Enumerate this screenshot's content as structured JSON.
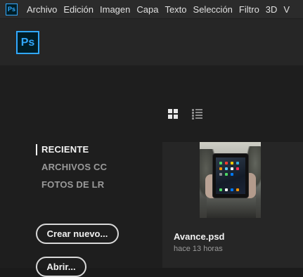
{
  "menubar": {
    "app_icon": "Ps",
    "items": [
      "Archivo",
      "Edición",
      "Imagen",
      "Capa",
      "Texto",
      "Selección",
      "Filtro",
      "3D",
      "V"
    ]
  },
  "header": {
    "logo": "Ps"
  },
  "view_toggle": {
    "grid": "grid-view-icon",
    "list": "list-view-icon"
  },
  "sidenav": {
    "items": [
      "RECIENTE",
      "ARCHIVOS CC",
      "FOTOS DE LR"
    ],
    "active": 0
  },
  "buttons": {
    "new": "Crear nuevo...",
    "open": "Abrir..."
  },
  "recent_files": [
    {
      "name": "Avance.psd",
      "modified": "hace 13 horas"
    }
  ],
  "colors": {
    "accent": "#31a8ff",
    "background": "#1e1e1e",
    "panel": "#262626"
  }
}
